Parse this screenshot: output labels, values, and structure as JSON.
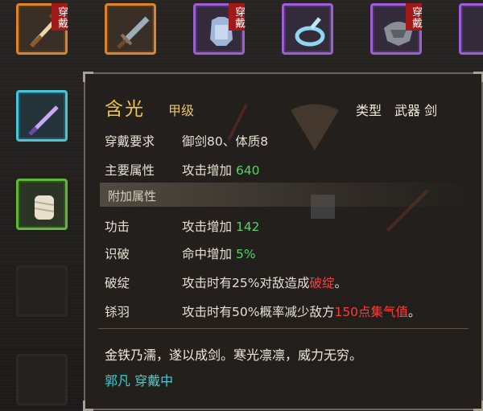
{
  "equipped_badge": "穿戴",
  "slots_row1": [
    {
      "icon": "wooden-sword-icon",
      "color": "#d9852e",
      "equipped": true
    },
    {
      "icon": "iron-sword-icon",
      "color": "#d9852e",
      "equipped": false
    },
    {
      "icon": "armor-icon",
      "color": "#9b5fd6",
      "equipped": true
    },
    {
      "icon": "jade-ornament-icon",
      "color": "#9b5fd6",
      "equipped": false
    },
    {
      "icon": "helmet-icon",
      "color": "#9b5fd6",
      "equipped": true
    }
  ],
  "slots_col": [
    {
      "icon": "purple-sword-icon",
      "color": "#4cc3d6"
    },
    {
      "icon": "bandage-glove-icon",
      "color": "#5fb83a"
    }
  ],
  "tooltip": {
    "name": "含光",
    "grade": "甲级",
    "type": "类型　武器 剑",
    "requirement_label": "穿戴要求",
    "requirement_value": "御剑80、体质8",
    "main_attr_label": "主要属性",
    "main_attr_text": "攻击增加",
    "main_attr_value": "640",
    "extra_section": "附加属性",
    "extras": [
      {
        "label": "功击",
        "text": "攻击增加",
        "value": "142"
      },
      {
        "label": "识破",
        "text": "命中增加",
        "value": "5%"
      }
    ],
    "skill1_label": "破绽",
    "skill1_text": "攻击时有25%对敌造成",
    "skill1_hl": "破绽",
    "skill1_end": "。",
    "skill2_label": "铩羽",
    "skill2_text": "攻击时有50%概率减少敌方",
    "skill2_hl": "150点集气值",
    "skill2_end": "。",
    "description": "金铁乃濡，遂以成剑。寒光凛凛，威力无穷。",
    "owner": "郭凡 穿戴中"
  }
}
